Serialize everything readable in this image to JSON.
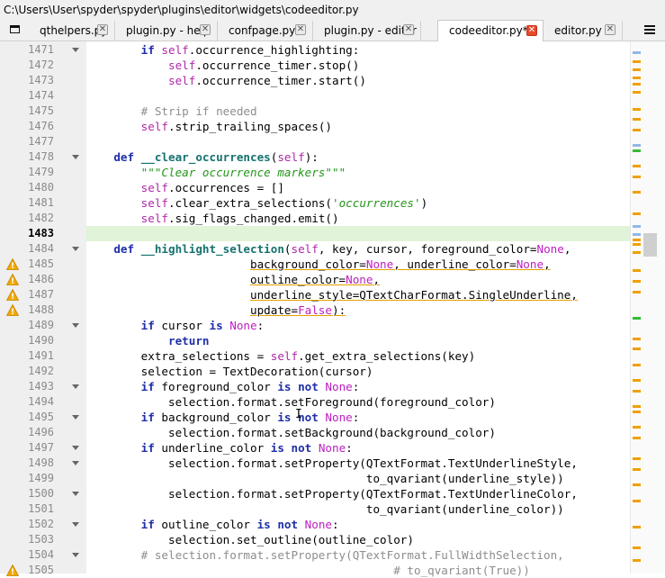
{
  "path": "C:\\Users\\User\\spyder\\spyder\\plugins\\editor\\widgets\\codeeditor.py",
  "tabs": [
    {
      "label": "qthelpers.py",
      "active": false
    },
    {
      "label": "plugin.py - help",
      "active": false
    },
    {
      "label": "confpage.py",
      "active": false
    },
    {
      "label": "plugin.py - editor",
      "active": false
    },
    {
      "label": "codeeditor.py*",
      "active": true
    },
    {
      "label": "editor.py",
      "active": false
    }
  ],
  "current_line": "1483",
  "lines": [
    {
      "num": "1471",
      "fold": true,
      "warn": false,
      "tokens": [
        [
          "        ",
          ""
        ],
        [
          "if ",
          "kw"
        ],
        [
          "self",
          "self"
        ],
        [
          ".occurrence_highlighting:",
          ""
        ]
      ]
    },
    {
      "num": "1472",
      "fold": false,
      "warn": false,
      "tokens": [
        [
          "            ",
          ""
        ],
        [
          "self",
          "self"
        ],
        [
          ".occurrence_timer.stop()",
          ""
        ]
      ]
    },
    {
      "num": "1473",
      "fold": false,
      "warn": false,
      "tokens": [
        [
          "            ",
          ""
        ],
        [
          "self",
          "self"
        ],
        [
          ".occurrence_timer.start()",
          ""
        ]
      ]
    },
    {
      "num": "1474",
      "fold": false,
      "warn": false,
      "tokens": []
    },
    {
      "num": "1475",
      "fold": false,
      "warn": false,
      "tokens": [
        [
          "        ",
          ""
        ],
        [
          "# Strip if needed",
          "cmt"
        ]
      ]
    },
    {
      "num": "1476",
      "fold": false,
      "warn": false,
      "tokens": [
        [
          "        ",
          ""
        ],
        [
          "self",
          "self"
        ],
        [
          ".strip_trailing_spaces()",
          ""
        ]
      ]
    },
    {
      "num": "1477",
      "fold": false,
      "warn": false,
      "tokens": []
    },
    {
      "num": "1478",
      "fold": true,
      "warn": false,
      "tokens": [
        [
          "    ",
          ""
        ],
        [
          "def ",
          "kw"
        ],
        [
          "__clear_occurrences",
          "fn"
        ],
        [
          "(",
          ""
        ],
        [
          "self",
          "self"
        ],
        [
          "):",
          ""
        ]
      ]
    },
    {
      "num": "1479",
      "fold": false,
      "warn": false,
      "tokens": [
        [
          "        ",
          ""
        ],
        [
          "\"\"\"Clear occurrence markers\"\"\"",
          "str"
        ]
      ]
    },
    {
      "num": "1480",
      "fold": false,
      "warn": false,
      "tokens": [
        [
          "        ",
          ""
        ],
        [
          "self",
          "self"
        ],
        [
          ".occurrences = []",
          ""
        ]
      ]
    },
    {
      "num": "1481",
      "fold": false,
      "warn": false,
      "tokens": [
        [
          "        ",
          ""
        ],
        [
          "self",
          "self"
        ],
        [
          ".clear_extra_selections(",
          ""
        ],
        [
          "'occurrences'",
          "str"
        ],
        [
          ")",
          ""
        ]
      ]
    },
    {
      "num": "1482",
      "fold": false,
      "warn": false,
      "tokens": [
        [
          "        ",
          ""
        ],
        [
          "self",
          "self"
        ],
        [
          ".sig_flags_changed.emit()",
          ""
        ]
      ]
    },
    {
      "num": "1483",
      "fold": false,
      "warn": false,
      "tokens": []
    },
    {
      "num": "1484",
      "fold": true,
      "warn": false,
      "tokens": [
        [
          "    ",
          ""
        ],
        [
          "def ",
          "kw"
        ],
        [
          "__highlight_selection",
          "fn"
        ],
        [
          "(",
          ""
        ],
        [
          "self",
          "self"
        ],
        [
          ", key, cursor, foreground_color=",
          ""
        ],
        [
          "None",
          "const"
        ],
        [
          ",",
          ""
        ]
      ]
    },
    {
      "num": "1485",
      "fold": false,
      "warn": true,
      "tokens": [
        [
          "                        ",
          ""
        ],
        [
          "background_color=",
          "wavy"
        ],
        [
          "None",
          "const wavy"
        ],
        [
          ", underline_color=",
          "wavy"
        ],
        [
          "None",
          "const wavy"
        ],
        [
          ",",
          "wavy"
        ]
      ]
    },
    {
      "num": "1486",
      "fold": false,
      "warn": true,
      "tokens": [
        [
          "                        ",
          ""
        ],
        [
          "outline_color=",
          "wavy"
        ],
        [
          "None",
          "const wavy"
        ],
        [
          ",",
          "wavy"
        ]
      ]
    },
    {
      "num": "1487",
      "fold": false,
      "warn": true,
      "tokens": [
        [
          "                        ",
          ""
        ],
        [
          "underline_style=QTextCharFormat.SingleUnderline,",
          "wavy"
        ]
      ]
    },
    {
      "num": "1488",
      "fold": false,
      "warn": true,
      "tokens": [
        [
          "                        ",
          ""
        ],
        [
          "update=",
          "wavy"
        ],
        [
          "False",
          "const wavy"
        ],
        [
          "):",
          "wavy"
        ]
      ]
    },
    {
      "num": "1489",
      "fold": true,
      "warn": false,
      "tokens": [
        [
          "        ",
          ""
        ],
        [
          "if ",
          "kw"
        ],
        [
          "cursor ",
          ""
        ],
        [
          "is ",
          "kw"
        ],
        [
          "None",
          "const"
        ],
        [
          ":",
          ""
        ]
      ]
    },
    {
      "num": "1490",
      "fold": false,
      "warn": false,
      "tokens": [
        [
          "            ",
          ""
        ],
        [
          "return",
          "kw"
        ]
      ]
    },
    {
      "num": "1491",
      "fold": false,
      "warn": false,
      "tokens": [
        [
          "        ",
          ""
        ],
        [
          "extra_selections = ",
          ""
        ],
        [
          "self",
          "self"
        ],
        [
          ".get_extra_selections(key)",
          ""
        ]
      ]
    },
    {
      "num": "1492",
      "fold": false,
      "warn": false,
      "tokens": [
        [
          "        ",
          ""
        ],
        [
          "selection = TextDecoration(cursor)",
          ""
        ]
      ]
    },
    {
      "num": "1493",
      "fold": true,
      "warn": false,
      "tokens": [
        [
          "        ",
          ""
        ],
        [
          "if ",
          "kw"
        ],
        [
          "foreground_color ",
          ""
        ],
        [
          "is not ",
          "kw"
        ],
        [
          "None",
          "const"
        ],
        [
          ":",
          ""
        ]
      ]
    },
    {
      "num": "1494",
      "fold": false,
      "warn": false,
      "tokens": [
        [
          "            ",
          ""
        ],
        [
          "selection.format.setForeground(foreground_color)",
          ""
        ]
      ]
    },
    {
      "num": "1495",
      "fold": true,
      "warn": false,
      "tokens": [
        [
          "        ",
          ""
        ],
        [
          "if ",
          "kw"
        ],
        [
          "background_color ",
          ""
        ],
        [
          "is not ",
          "kw"
        ],
        [
          "None",
          "const"
        ],
        [
          ":",
          ""
        ]
      ]
    },
    {
      "num": "1496",
      "fold": false,
      "warn": false,
      "tokens": [
        [
          "            ",
          ""
        ],
        [
          "selection.format.setBackground(background_color)",
          ""
        ]
      ]
    },
    {
      "num": "1497",
      "fold": true,
      "warn": false,
      "tokens": [
        [
          "        ",
          ""
        ],
        [
          "if ",
          "kw"
        ],
        [
          "underline_color ",
          ""
        ],
        [
          "is not ",
          "kw"
        ],
        [
          "None",
          "const"
        ],
        [
          ":",
          ""
        ]
      ]
    },
    {
      "num": "1498",
      "fold": true,
      "warn": false,
      "tokens": [
        [
          "            ",
          ""
        ],
        [
          "selection.format.setProperty(QTextFormat.TextUnderlineStyle,",
          ""
        ]
      ]
    },
    {
      "num": "1499",
      "fold": false,
      "warn": false,
      "tokens": [
        [
          "                                         ",
          ""
        ],
        [
          "to_qvariant(underline_style))",
          ""
        ]
      ]
    },
    {
      "num": "1500",
      "fold": true,
      "warn": false,
      "tokens": [
        [
          "            ",
          ""
        ],
        [
          "selection.format.setProperty(QTextFormat.TextUnderlineColor,",
          ""
        ]
      ]
    },
    {
      "num": "1501",
      "fold": false,
      "warn": false,
      "tokens": [
        [
          "                                         ",
          ""
        ],
        [
          "to_qvariant(underline_color))",
          ""
        ]
      ]
    },
    {
      "num": "1502",
      "fold": true,
      "warn": false,
      "tokens": [
        [
          "        ",
          ""
        ],
        [
          "if ",
          "kw"
        ],
        [
          "outline_color ",
          ""
        ],
        [
          "is not ",
          "kw"
        ],
        [
          "None",
          "const"
        ],
        [
          ":",
          ""
        ]
      ]
    },
    {
      "num": "1503",
      "fold": false,
      "warn": false,
      "tokens": [
        [
          "            ",
          ""
        ],
        [
          "selection.set_outline(outline_color)",
          ""
        ]
      ]
    },
    {
      "num": "1504",
      "fold": true,
      "warn": false,
      "tokens": [
        [
          "        ",
          ""
        ],
        [
          "# selection.format.setProperty(QTextFormat.FullWidthSelection,",
          "cmt"
        ]
      ]
    },
    {
      "num": "1505",
      "fold": false,
      "warn": true,
      "tokens": [
        [
          "                                             ",
          ""
        ],
        [
          "# to_qvariant(True))",
          "cmt"
        ]
      ]
    }
  ],
  "colors": {
    "warning": "#f0a800",
    "current_line_bg": "#e1f3d8",
    "marker_orange": "#f0a000",
    "marker_green": "#33bb33",
    "marker_blue": "#8fb8e6"
  },
  "scroll_markers": [
    {
      "pos": 0.012,
      "color": "marker_blue"
    },
    {
      "pos": 0.03,
      "color": "marker_orange"
    },
    {
      "pos": 0.045,
      "color": "marker_orange"
    },
    {
      "pos": 0.06,
      "color": "marker_orange"
    },
    {
      "pos": 0.072,
      "color": "marker_orange"
    },
    {
      "pos": 0.088,
      "color": "marker_orange"
    },
    {
      "pos": 0.12,
      "color": "marker_orange"
    },
    {
      "pos": 0.14,
      "color": "marker_orange"
    },
    {
      "pos": 0.16,
      "color": "marker_orange"
    },
    {
      "pos": 0.19,
      "color": "marker_blue"
    },
    {
      "pos": 0.2,
      "color": "marker_green"
    },
    {
      "pos": 0.23,
      "color": "marker_orange"
    },
    {
      "pos": 0.25,
      "color": "marker_orange"
    },
    {
      "pos": 0.28,
      "color": "marker_orange"
    },
    {
      "pos": 0.32,
      "color": "marker_orange"
    },
    {
      "pos": 0.345,
      "color": "marker_blue"
    },
    {
      "pos": 0.36,
      "color": "marker_blue"
    },
    {
      "pos": 0.37,
      "color": "marker_orange"
    },
    {
      "pos": 0.38,
      "color": "marker_orange"
    },
    {
      "pos": 0.395,
      "color": "marker_orange"
    },
    {
      "pos": 0.43,
      "color": "marker_orange"
    },
    {
      "pos": 0.45,
      "color": "marker_orange"
    },
    {
      "pos": 0.47,
      "color": "marker_orange"
    },
    {
      "pos": 0.52,
      "color": "marker_green"
    },
    {
      "pos": 0.56,
      "color": "marker_orange"
    },
    {
      "pos": 0.58,
      "color": "marker_orange"
    },
    {
      "pos": 0.61,
      "color": "marker_orange"
    },
    {
      "pos": 0.64,
      "color": "marker_orange"
    },
    {
      "pos": 0.66,
      "color": "marker_orange"
    },
    {
      "pos": 0.69,
      "color": "marker_orange"
    },
    {
      "pos": 0.7,
      "color": "marker_orange"
    },
    {
      "pos": 0.73,
      "color": "marker_orange"
    },
    {
      "pos": 0.75,
      "color": "marker_orange"
    },
    {
      "pos": 0.79,
      "color": "marker_orange"
    },
    {
      "pos": 0.81,
      "color": "marker_orange"
    },
    {
      "pos": 0.84,
      "color": "marker_orange"
    },
    {
      "pos": 0.87,
      "color": "marker_orange"
    },
    {
      "pos": 0.92,
      "color": "marker_orange"
    },
    {
      "pos": 0.96,
      "color": "marker_orange"
    },
    {
      "pos": 0.985,
      "color": "marker_orange"
    }
  ],
  "icons": {
    "browse_tabs": "browse-tabs-icon",
    "close_tab": "close-tab-icon",
    "options_menu": "hamburger-menu-icon",
    "warning": "warning-icon",
    "fold": "fold-arrow-icon"
  }
}
